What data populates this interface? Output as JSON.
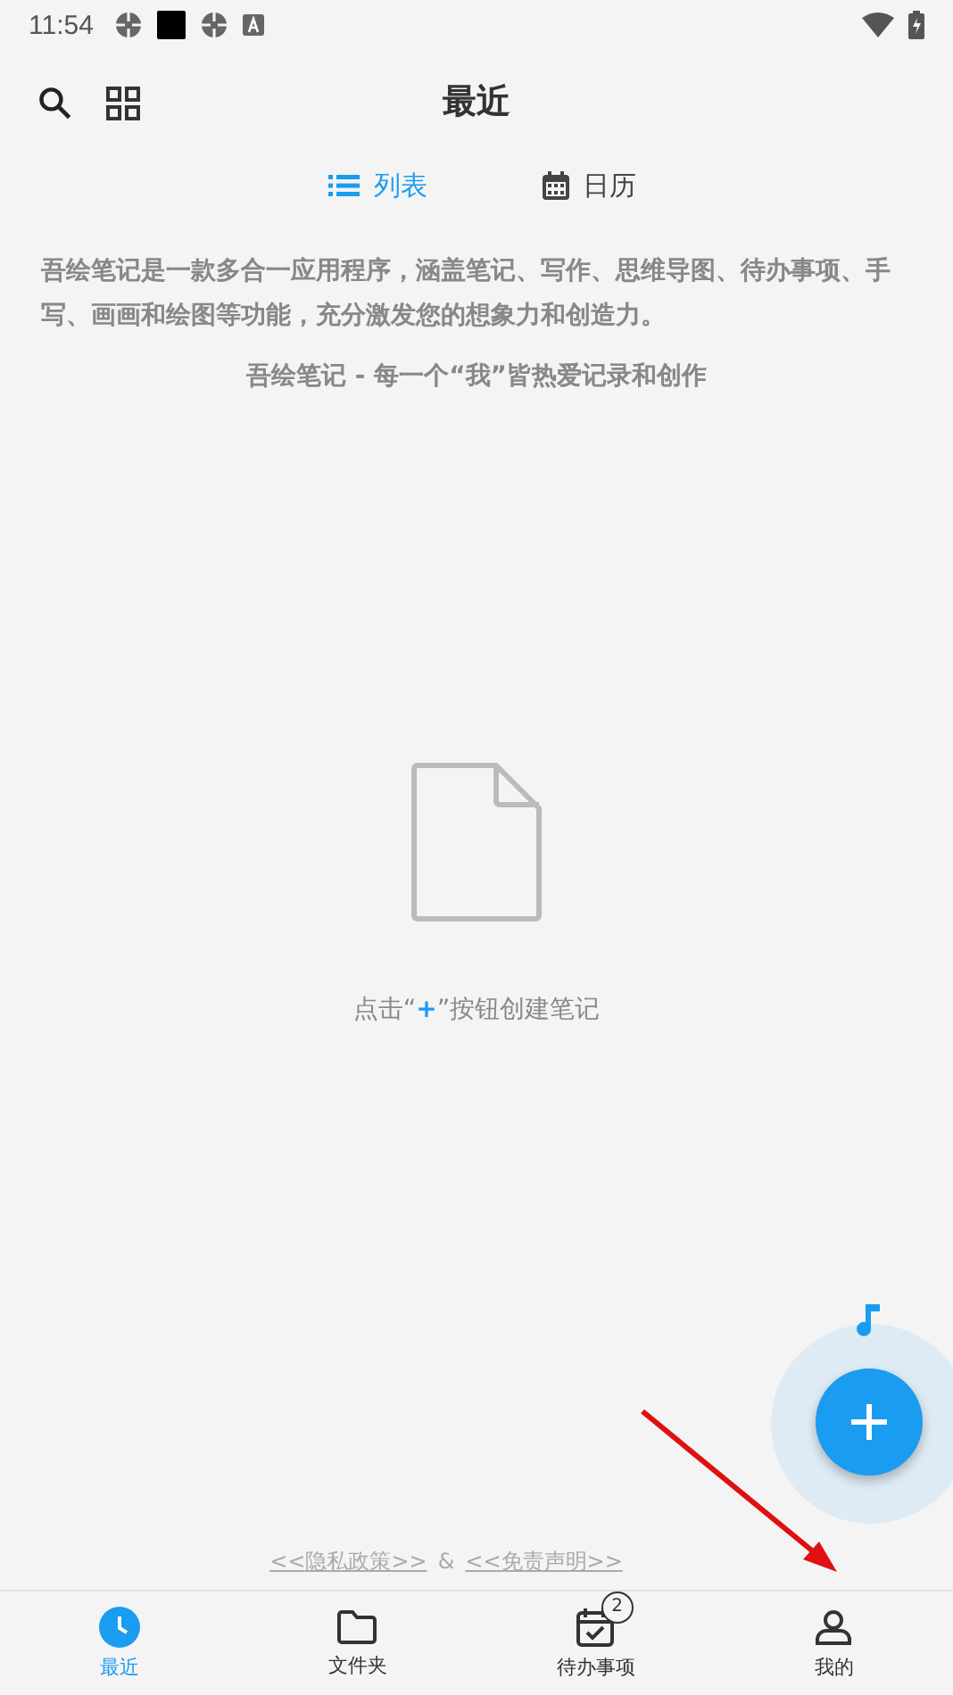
{
  "status_bar": {
    "time": "11:54"
  },
  "header": {
    "title": "最近"
  },
  "view_tabs": [
    {
      "label": "列表",
      "kind": "list",
      "selected": true
    },
    {
      "label": "日历",
      "kind": "calendar",
      "selected": false
    }
  ],
  "intro": {
    "description": "吾绘笔记是一款多合一应用程序，涵盖笔记、写作、思维导图、待办事项、手写、画画和绘图等功能，充分激发您的想象力和创造力。",
    "slogan": "吾绘笔记 - 每一个“我”皆热爱记录和创作"
  },
  "empty_state": {
    "hint_before": "点击“",
    "hint_plus": "+",
    "hint_after": "”按钮创建笔记"
  },
  "legal": {
    "privacy": "<<隐私政策>>",
    "separator": "&",
    "disclaimer": "<<免责声明>>"
  },
  "bottom_nav": [
    {
      "label": "最近",
      "kind": "recent",
      "selected": true
    },
    {
      "label": "文件夹",
      "kind": "folder",
      "selected": false
    },
    {
      "label": "待办事项",
      "kind": "todo",
      "selected": false,
      "badge": "2"
    },
    {
      "label": "我的",
      "kind": "profile",
      "selected": false
    }
  ]
}
